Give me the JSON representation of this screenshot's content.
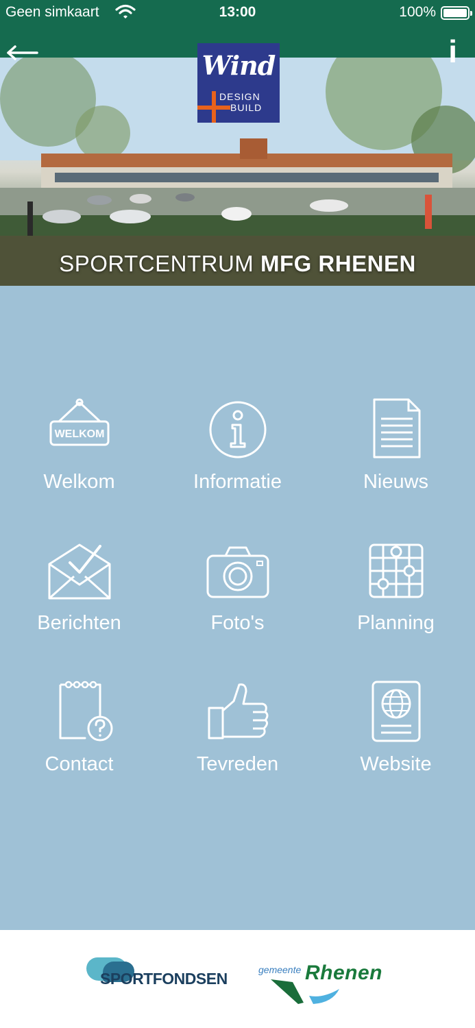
{
  "status_bar": {
    "carrier": "Geen simkaart",
    "time": "13:00",
    "battery": "100%"
  },
  "nav": {
    "back_icon": "arrow-left-icon",
    "info_label": "i"
  },
  "hero": {
    "title_light": "SPORTCENTRUM ",
    "title_bold": "MFG RHENEN",
    "logo": {
      "word": "Wind",
      "line1": "DESIGN",
      "line2": "BUILD"
    }
  },
  "menu": {
    "items": [
      {
        "label": "Welkom",
        "icon": "welcome-sign-icon",
        "sign_text": "WELKOM"
      },
      {
        "label": "Informatie",
        "icon": "info-circle-icon"
      },
      {
        "label": "Nieuws",
        "icon": "document-icon"
      },
      {
        "label": "Berichten",
        "icon": "envelope-check-icon"
      },
      {
        "label": "Foto's",
        "icon": "camera-icon"
      },
      {
        "label": "Planning",
        "icon": "planning-grid-icon"
      },
      {
        "label": "Contact",
        "icon": "notepad-question-icon"
      },
      {
        "label": "Tevreden",
        "icon": "thumbs-up-icon"
      },
      {
        "label": "Website",
        "icon": "globe-icon"
      }
    ]
  },
  "footer": {
    "sportfondsen": "SPORTFONDSEN",
    "gemeente": "gemeente",
    "rhenen": "Rhenen"
  },
  "colors": {
    "status_bar": "#156b4f",
    "background": "#9fc1d6",
    "logo_blue": "#2d3a8c",
    "logo_orange": "#e8621c"
  }
}
